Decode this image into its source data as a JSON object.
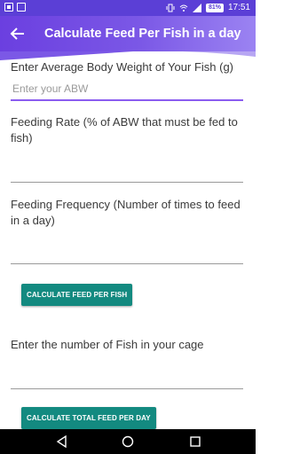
{
  "status_bar": {
    "battery": "81%",
    "time": "17:51"
  },
  "app_bar": {
    "title": "Calculate Feed Per Fish in a day",
    "back_icon": "arrow-left-icon",
    "gradient": [
      "#6b3fe0",
      "#9b83f2"
    ]
  },
  "form": {
    "abw_label": "Enter Average Body Weight of Your Fish (g)",
    "abw_placeholder": "Enter your ABW",
    "abw_value": "",
    "feeding_rate_label": "Feeding Rate (% of ABW that must be fed to fish)",
    "feeding_rate_value": "",
    "feeding_frequency_label": "Feeding Frequency (Number of times to feed in a day)",
    "feeding_frequency_value": "",
    "calc_feed_button": "CALCULATE FEED PER FISH",
    "fish_count_label": "Enter the number of Fish in your cage",
    "fish_count_value": "",
    "calc_total_button": "CALCULATE TOTAL FEED PER DAY"
  },
  "colors": {
    "primary": "#6b3fe0",
    "status_bar": "#5b3fd6",
    "button": "#138a80",
    "focus_underline": "#8a5cf0"
  },
  "nav_bar": {
    "back_icon": "triangle-back-icon",
    "home_icon": "circle-home-icon",
    "recents_icon": "square-recents-icon"
  }
}
